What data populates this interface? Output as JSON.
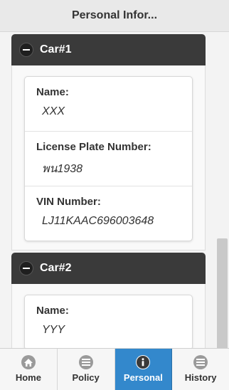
{
  "header": {
    "title": "Personal Infor..."
  },
  "cars": [
    {
      "title": "Car#1",
      "fields": [
        {
          "label": "Name:",
          "value": "XXX"
        },
        {
          "label": "License Plate Number:",
          "value": "พน1938"
        },
        {
          "label": "VIN Number:",
          "value": "LJ11KAAC696003648"
        }
      ]
    },
    {
      "title": "Car#2",
      "fields": [
        {
          "label": "Name:",
          "value": "YYY"
        }
      ]
    }
  ],
  "tabs": [
    {
      "label": "Home",
      "icon": "home-icon"
    },
    {
      "label": "Policy",
      "icon": "list-icon"
    },
    {
      "label": "Personal",
      "icon": "info-icon",
      "active": true
    },
    {
      "label": "History",
      "icon": "list-icon"
    }
  ],
  "colors": {
    "header_bar": "#3a3a3a",
    "active_tab": "#3388cc"
  }
}
